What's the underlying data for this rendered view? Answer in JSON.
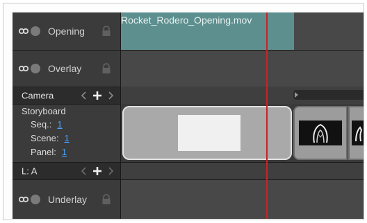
{
  "layers": {
    "opening": {
      "name": "Opening"
    },
    "overlay": {
      "name": "Overlay"
    },
    "underlay": {
      "name": "Underlay"
    }
  },
  "camera": {
    "label": "Camera"
  },
  "storyboard": {
    "title": "Storyboard",
    "seq_label": "Seq.:",
    "seq_value": "1",
    "scene_label": "Scene:",
    "scene_value": "1",
    "panel_label": "Panel:",
    "panel_value": "1"
  },
  "audio_layer": {
    "label": "L: A"
  },
  "clip": {
    "filename": "Rocket_Rodero_Opening.mov"
  },
  "colors": {
    "playhead": "#c3252a",
    "movie_clip": "#5d8f8f",
    "link": "#4aa3ff"
  },
  "icons": [
    "link-icon",
    "visibility-dot-icon",
    "lock-icon",
    "prev-arrow-icon",
    "add-icon",
    "next-arrow-icon"
  ]
}
